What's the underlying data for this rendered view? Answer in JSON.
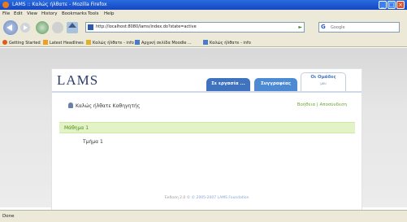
{
  "window": {
    "title": "LAMS :: Καλώς ήλθατε - Mozilla Firefox"
  },
  "menu": [
    "File",
    "Edit",
    "View",
    "History",
    "Bookmarks",
    "Tools",
    "Help"
  ],
  "nav": {
    "url": "http://localhost:8080/lams/index.do?state=active",
    "search_placeholder": "Google"
  },
  "bookmarks": [
    {
      "label": "Getting Started",
      "icon": "firefox-icon",
      "color": "#e05a1a"
    },
    {
      "label": "Latest Headlines",
      "icon": "rss-icon",
      "color": "#f0a020"
    },
    {
      "label": "Καλώς ήλθατε - info",
      "icon": "folder-icon",
      "color": "#e0b030"
    },
    {
      "label": "Αρχική σελίδα Moodle ...",
      "icon": "page-icon",
      "color": "#4a7ac8"
    },
    {
      "label": "Καλώς ήλθατε - info",
      "icon": "page-icon",
      "color": "#4a7ac8"
    }
  ],
  "app": {
    "logo": "LAMS",
    "tabs": [
      {
        "label": "Σε εργασία ..."
      },
      {
        "label": "Συγγραφέας"
      },
      {
        "label": "Οι Ομάδες",
        "sub": "μου"
      }
    ],
    "welcome": "Καλώς ήλθατε Καθηγητής",
    "actions": {
      "first": "Βοήθεια",
      "separator": "|",
      "second": "Αποσύνδεση"
    },
    "lesson_title": "Μάθημα 1",
    "group_name": "Τμήμα 1",
    "footer_version": "Έκδοση 2.0 ©",
    "footer_link": "© 2005-2007 LAMS Foundation"
  },
  "status": "Done"
}
